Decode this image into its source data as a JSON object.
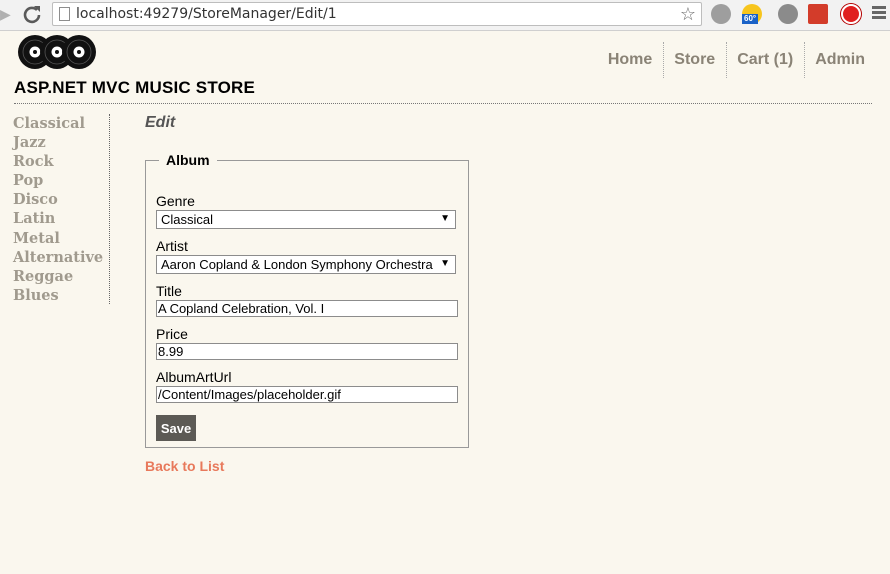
{
  "browser": {
    "url": "localhost:49279/StoreManager/Edit/1",
    "weather_badge": "60°"
  },
  "site": {
    "title": "ASP.NET MVC MUSIC STORE",
    "nav": [
      "Home",
      "Store",
      "Cart (1)",
      "Admin"
    ]
  },
  "categories": [
    "Classical",
    "Jazz",
    "Rock",
    "Pop",
    "Disco",
    "Latin",
    "Metal",
    "Alternative",
    "Reggae",
    "Blues"
  ],
  "page": {
    "heading": "Edit",
    "legend": "Album",
    "genre_label": "Genre",
    "genre_value": "Classical",
    "artist_label": "Artist",
    "artist_value": "Aaron Copland & London Symphony Orchestra",
    "title_label": "Title",
    "title_value": "A Copland Celebration, Vol. I",
    "price_label": "Price",
    "price_value": "8.99",
    "albumart_label": "AlbumArtUrl",
    "albumart_value": "/Content/Images/placeholder.gif",
    "save_label": "Save",
    "back_label": "Back to List"
  }
}
